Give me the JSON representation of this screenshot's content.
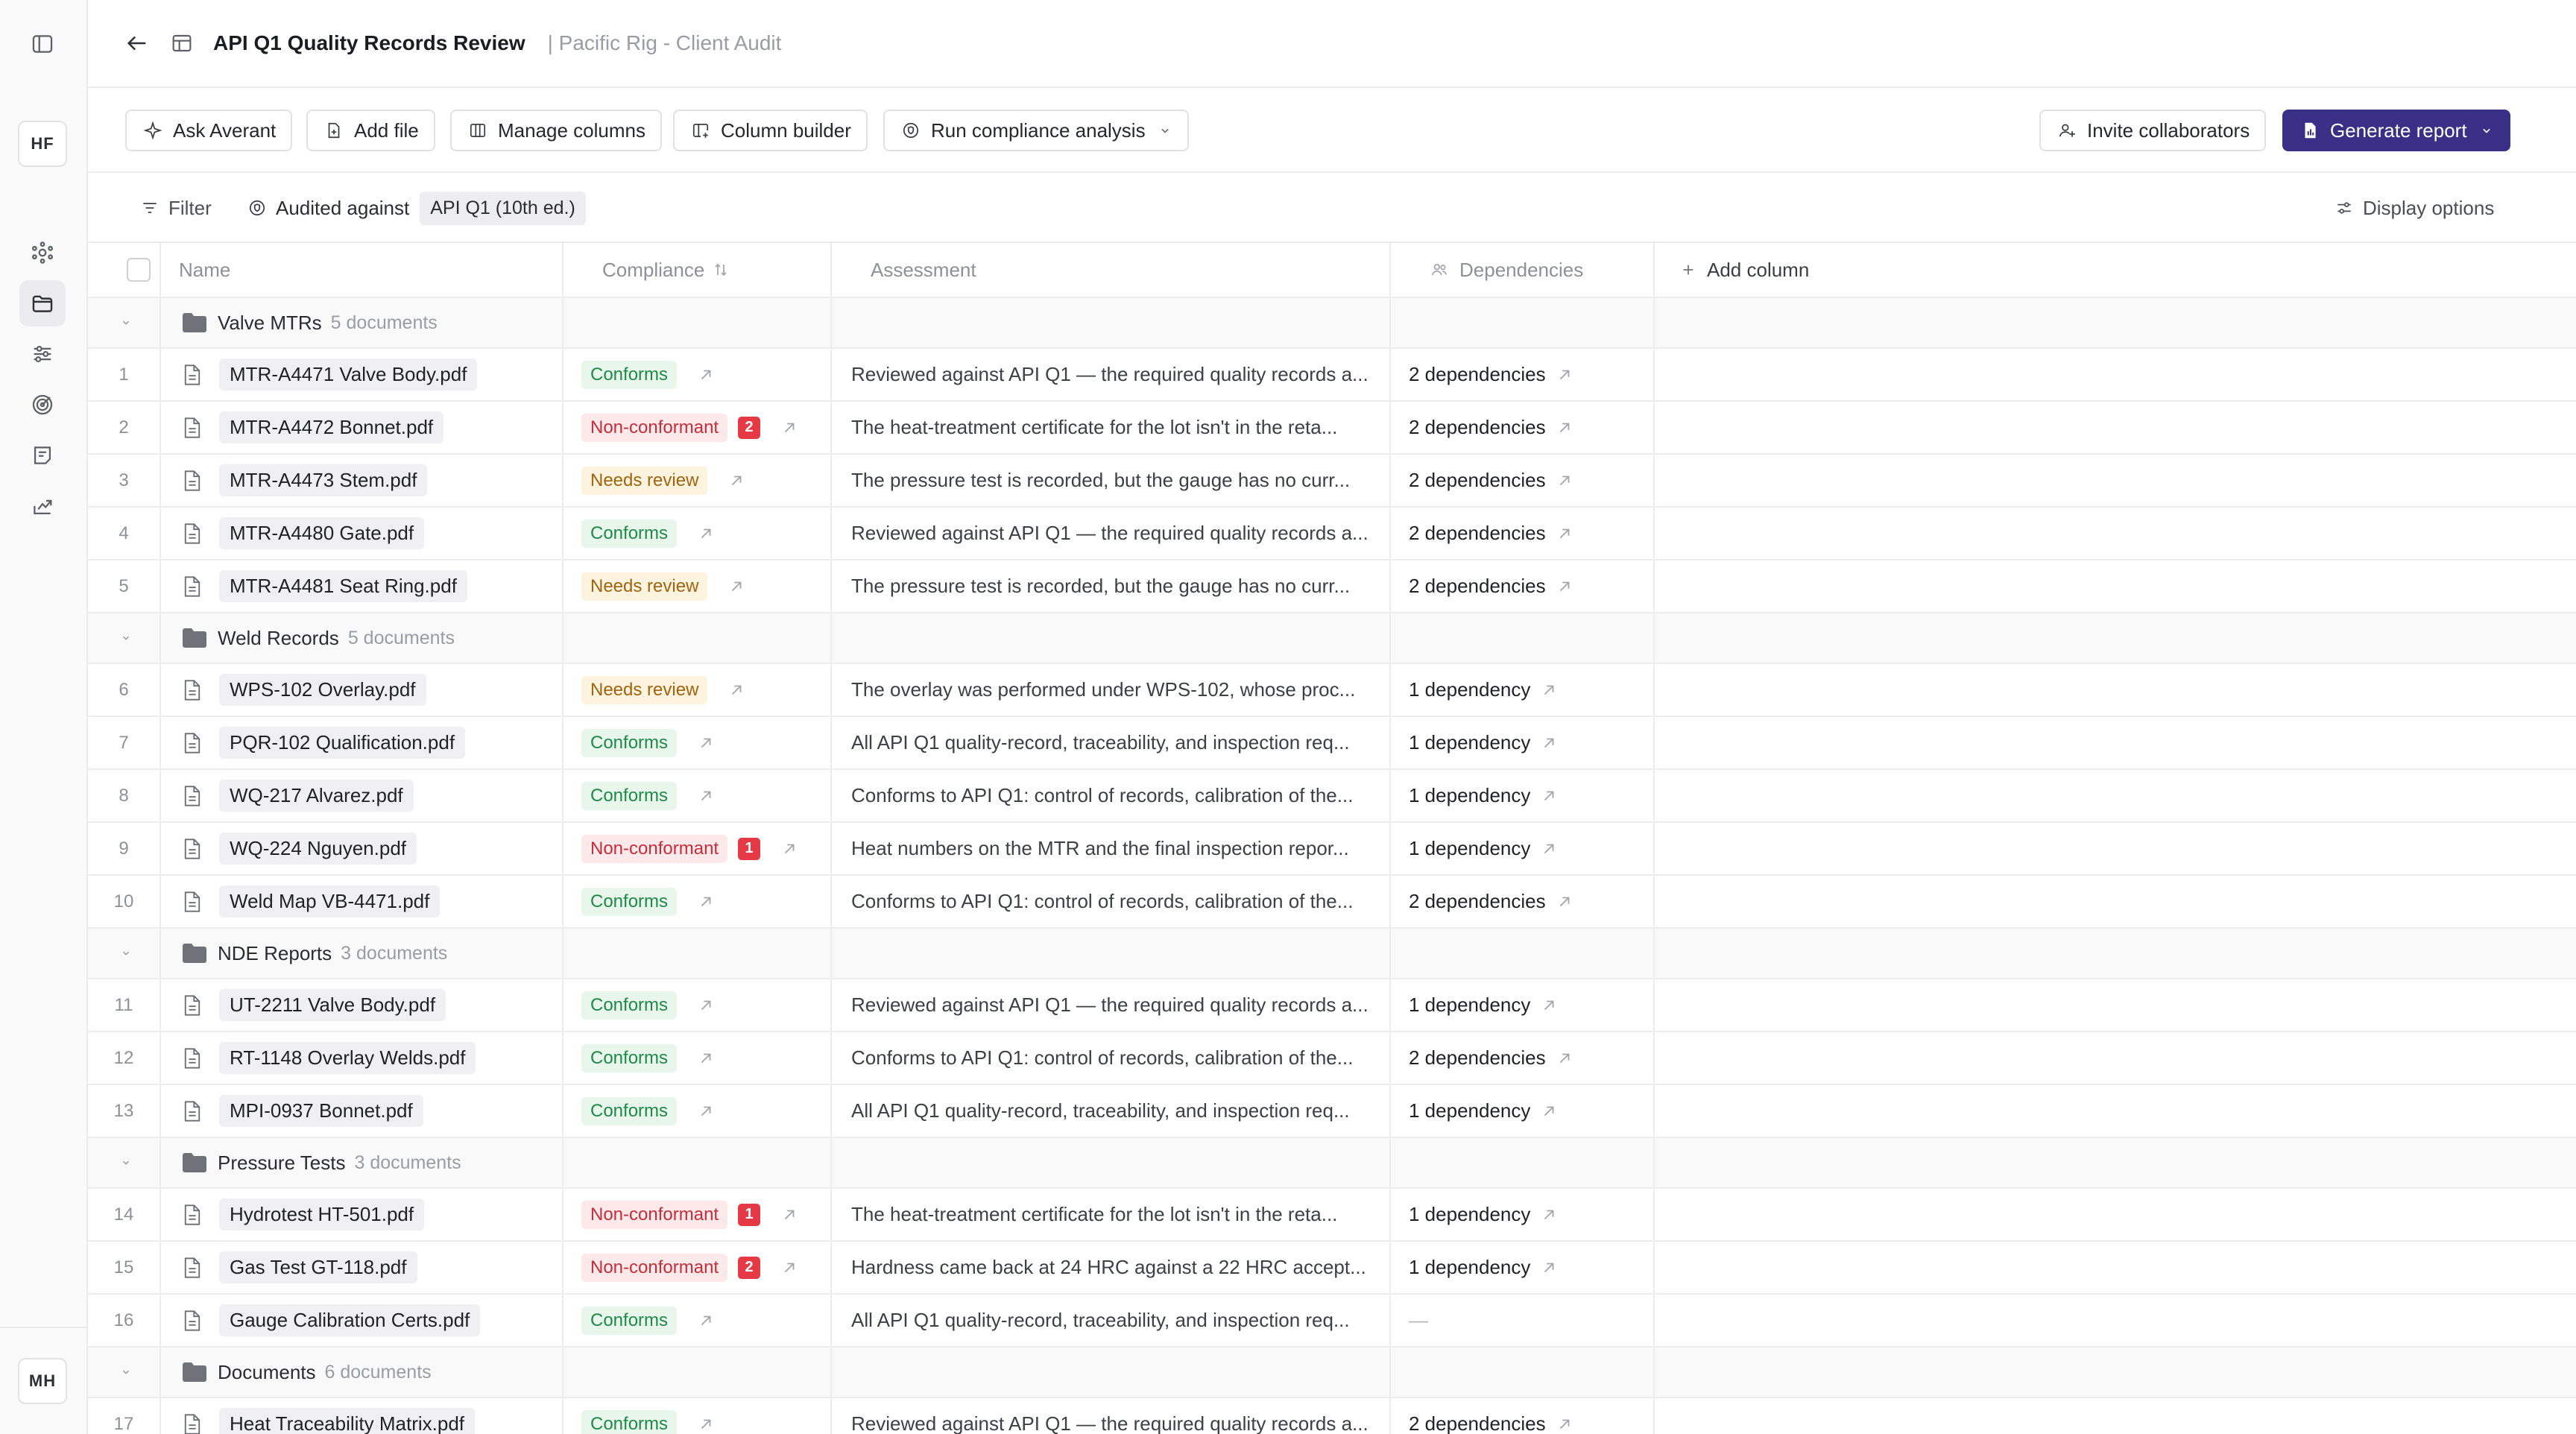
{
  "sidebar": {
    "workspace_initials": "HF",
    "user_initials": "MH",
    "icons": [
      "sidebar-toggle-icon",
      "network-icon",
      "folder-icon",
      "sliders-icon",
      "target-icon",
      "notes-icon",
      "share-icon"
    ]
  },
  "header": {
    "title": "API Q1 Quality Records Review",
    "subtitle": "| Pacific Rig - Client Audit"
  },
  "toolbar": {
    "ask": "Ask Averant",
    "add_file": "Add file",
    "manage_columns": "Manage columns",
    "column_builder": "Column builder",
    "run_analysis": "Run compliance analysis",
    "invite": "Invite collaborators",
    "generate": "Generate report"
  },
  "filterbar": {
    "filter": "Filter",
    "audited_label": "Audited against",
    "audited_value": "API Q1 (10th ed.)",
    "display_options": "Display options"
  },
  "columns": {
    "name": "Name",
    "compliance": "Compliance",
    "assessment": "Assessment",
    "dependencies": "Dependencies",
    "add_column": "Add column"
  },
  "colors": {
    "accent": "#3a2f86",
    "conforms": "#1f8a47",
    "non_conformant": "#c62d3a",
    "needs_review": "#a2630d"
  },
  "groups": [
    {
      "name": "Valve MTRs",
      "count": "5 documents",
      "rows": [
        {
          "num": "1",
          "file": "MTR-A4471 Valve Body.pdf",
          "status": "Conforms",
          "kind": "conforms",
          "issues": "",
          "assessment": "Reviewed against API Q1 — the required quality records a...",
          "deps": "2 dependencies"
        },
        {
          "num": "2",
          "file": "MTR-A4472 Bonnet.pdf",
          "status": "Non-conformant",
          "kind": "nonconf",
          "issues": "2",
          "assessment": "The heat-treatment certificate for the lot isn't in the reta...",
          "deps": "2 dependencies"
        },
        {
          "num": "3",
          "file": "MTR-A4473 Stem.pdf",
          "status": "Needs review",
          "kind": "review",
          "issues": "",
          "assessment": "The pressure test is recorded, but the gauge has no curr...",
          "deps": "2 dependencies"
        },
        {
          "num": "4",
          "file": "MTR-A4480 Gate.pdf",
          "status": "Conforms",
          "kind": "conforms",
          "issues": "",
          "assessment": "Reviewed against API Q1 — the required quality records a...",
          "deps": "2 dependencies"
        },
        {
          "num": "5",
          "file": "MTR-A4481 Seat Ring.pdf",
          "status": "Needs review",
          "kind": "review",
          "issues": "",
          "assessment": "The pressure test is recorded, but the gauge has no curr...",
          "deps": "2 dependencies"
        }
      ]
    },
    {
      "name": "Weld Records",
      "count": "5 documents",
      "rows": [
        {
          "num": "6",
          "file": "WPS-102 Overlay.pdf",
          "status": "Needs review",
          "kind": "review",
          "issues": "",
          "assessment": "The overlay was performed under WPS-102, whose proc...",
          "deps": "1 dependency"
        },
        {
          "num": "7",
          "file": "PQR-102 Qualification.pdf",
          "status": "Conforms",
          "kind": "conforms",
          "issues": "",
          "assessment": "All API Q1 quality-record, traceability, and inspection req...",
          "deps": "1 dependency"
        },
        {
          "num": "8",
          "file": "WQ-217 Alvarez.pdf",
          "status": "Conforms",
          "kind": "conforms",
          "issues": "",
          "assessment": "Conforms to API Q1: control of records, calibration of the...",
          "deps": "1 dependency"
        },
        {
          "num": "9",
          "file": "WQ-224 Nguyen.pdf",
          "status": "Non-conformant",
          "kind": "nonconf",
          "issues": "1",
          "assessment": "Heat numbers on the MTR and the final inspection repor...",
          "deps": "1 dependency"
        },
        {
          "num": "10",
          "file": "Weld Map VB-4471.pdf",
          "status": "Conforms",
          "kind": "conforms",
          "issues": "",
          "assessment": "Conforms to API Q1: control of records, calibration of the...",
          "deps": "2 dependencies"
        }
      ]
    },
    {
      "name": "NDE Reports",
      "count": "3 documents",
      "rows": [
        {
          "num": "11",
          "file": "UT-2211 Valve Body.pdf",
          "status": "Conforms",
          "kind": "conforms",
          "issues": "",
          "assessment": "Reviewed against API Q1 — the required quality records a...",
          "deps": "1 dependency"
        },
        {
          "num": "12",
          "file": "RT-1148 Overlay Welds.pdf",
          "status": "Conforms",
          "kind": "conforms",
          "issues": "",
          "assessment": "Conforms to API Q1: control of records, calibration of the...",
          "deps": "2 dependencies"
        },
        {
          "num": "13",
          "file": "MPI-0937 Bonnet.pdf",
          "status": "Conforms",
          "kind": "conforms",
          "issues": "",
          "assessment": "All API Q1 quality-record, traceability, and inspection req...",
          "deps": "1 dependency"
        }
      ]
    },
    {
      "name": "Pressure Tests",
      "count": "3 documents",
      "rows": [
        {
          "num": "14",
          "file": "Hydrotest HT-501.pdf",
          "status": "Non-conformant",
          "kind": "nonconf",
          "issues": "1",
          "assessment": "The heat-treatment certificate for the lot isn't in the reta...",
          "deps": "1 dependency"
        },
        {
          "num": "15",
          "file": "Gas Test GT-118.pdf",
          "status": "Non-conformant",
          "kind": "nonconf",
          "issues": "2",
          "assessment": "Hardness came back at 24 HRC against a 22 HRC accept...",
          "deps": "1 dependency"
        },
        {
          "num": "16",
          "file": "Gauge Calibration Certs.pdf",
          "status": "Conforms",
          "kind": "conforms",
          "issues": "",
          "assessment": "All API Q1 quality-record, traceability, and inspection req...",
          "deps": "—"
        }
      ]
    },
    {
      "name": "Documents",
      "count": "6 documents",
      "rows": [
        {
          "num": "17",
          "file": "Heat Traceability Matrix.pdf",
          "status": "Conforms",
          "kind": "conforms",
          "issues": "",
          "assessment": "Reviewed against API Q1 — the required quality records a...",
          "deps": "2 dependencies"
        }
      ]
    }
  ]
}
